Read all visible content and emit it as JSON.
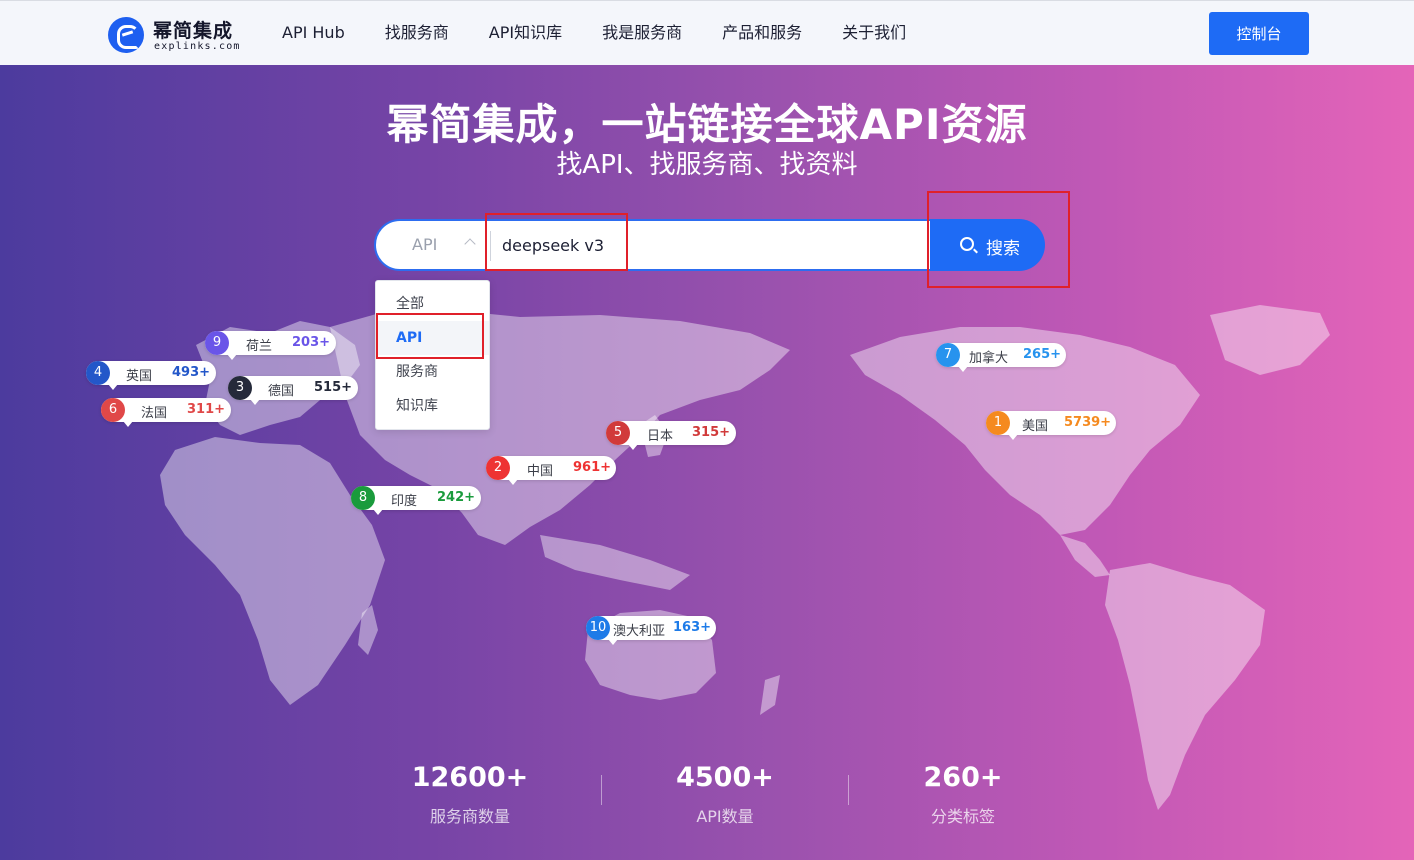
{
  "header": {
    "logo_cn": "幂简集成",
    "logo_en": "explinks.com",
    "nav": [
      "API Hub",
      "找服务商",
      "API知识库",
      "我是服务商",
      "产品和服务",
      "关于我们"
    ],
    "console_label": "控制台"
  },
  "hero": {
    "title": "幂简集成，一站链接全球API资源",
    "subtitle": "找API、找服务商、找资料"
  },
  "search": {
    "type_value": "API",
    "query": "deepseek v3",
    "button_label": "搜索"
  },
  "dropdown": {
    "options": [
      "全部",
      "API",
      "服务商",
      "知识库"
    ],
    "selected": "API"
  },
  "pins": [
    {
      "rank": "9",
      "name": "荷兰",
      "count": "203+",
      "color": "#6a55e8"
    },
    {
      "rank": "4",
      "name": "英国",
      "count": "493+",
      "color": "#2357c9"
    },
    {
      "rank": "3",
      "name": "德国",
      "count": "515+",
      "color": "#252a3a"
    },
    {
      "rank": "6",
      "name": "法国",
      "count": "311+",
      "color": "#e04848"
    },
    {
      "rank": "5",
      "name": "日本",
      "count": "315+",
      "color": "#d13a3a"
    },
    {
      "rank": "2",
      "name": "中国",
      "count": "961+",
      "color": "#ee3333"
    },
    {
      "rank": "8",
      "name": "印度",
      "count": "242+",
      "color": "#1a9b3c"
    },
    {
      "rank": "10",
      "name": "澳大利亚",
      "count": "163+",
      "color": "#1e7be8"
    },
    {
      "rank": "7",
      "name": "加拿大",
      "count": "265+",
      "color": "#2793ee"
    },
    {
      "rank": "1",
      "name": "美国",
      "count": "5739+",
      "color": "#f58a1f"
    }
  ],
  "stats": [
    {
      "value": "12600+",
      "label": "服务商数量"
    },
    {
      "value": "4500+",
      "label": "API数量"
    },
    {
      "value": "260+",
      "label": "分类标签"
    }
  ]
}
